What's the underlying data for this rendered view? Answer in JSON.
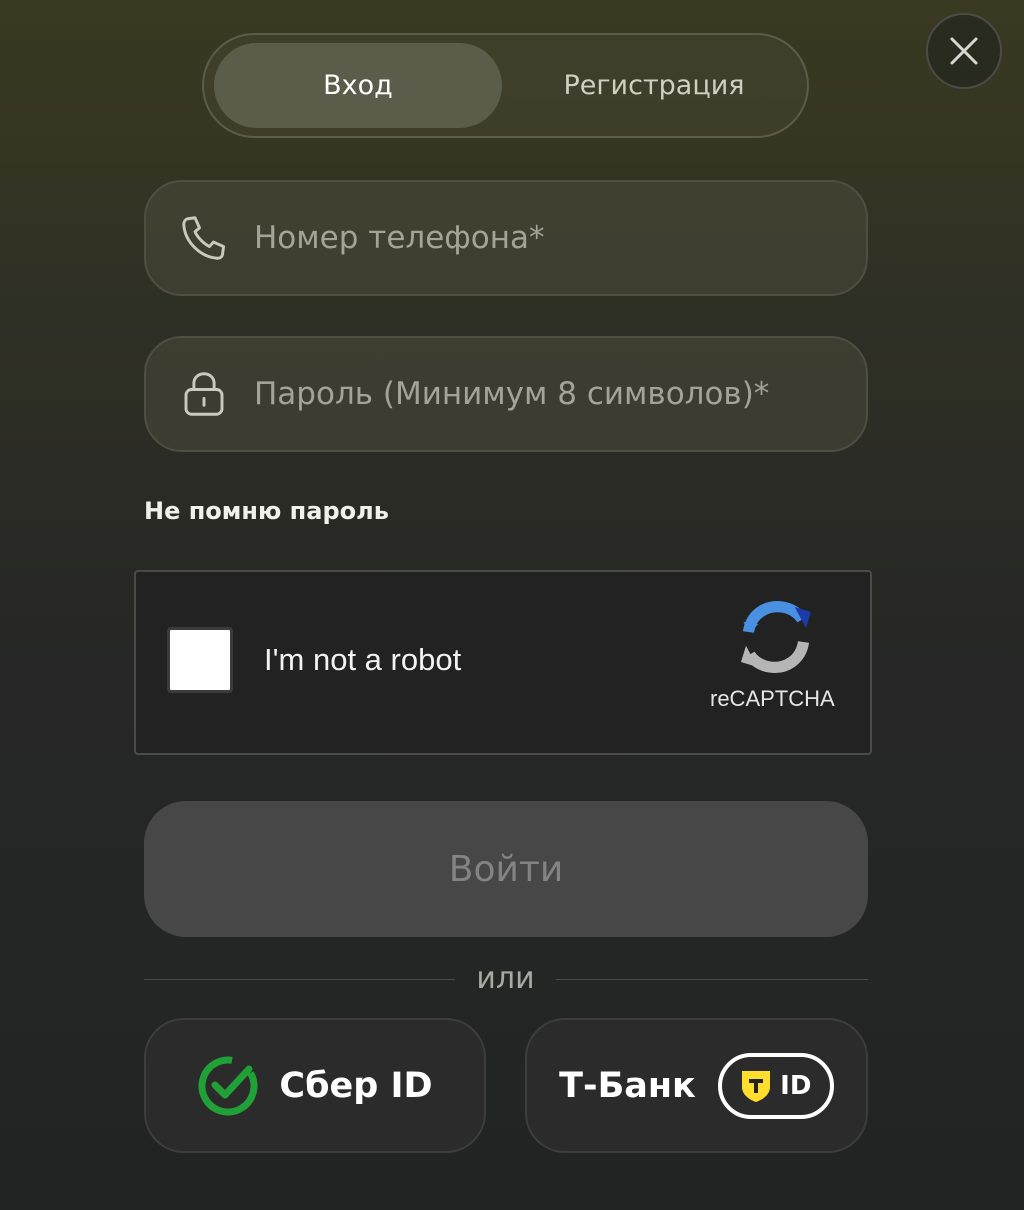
{
  "tabs": [
    {
      "label": "Вход",
      "active": true
    },
    {
      "label": "Регистрация",
      "active": false
    }
  ],
  "phone": {
    "placeholder": "Номер телефона*",
    "value": "",
    "icon": "phone-icon"
  },
  "password": {
    "placeholder": "Пароль (Минимум 8 символов)*",
    "value": "",
    "icon": "lock-icon"
  },
  "forgot_label": "Не помню пароль",
  "captcha": {
    "label": "I'm not a robot",
    "brand": "reCAPTCHA",
    "checked": false
  },
  "submit_label": "Войти",
  "divider_text": "или",
  "providers": {
    "sber": {
      "label": "Сбер ID",
      "color": "#21a038"
    },
    "tbank": {
      "label": "Т-Банк",
      "badge_text": "ID",
      "color": "#ffdd2d"
    }
  },
  "colors": {
    "accent_tab": "#5b5c4a",
    "submit_disabled": "#474747"
  }
}
